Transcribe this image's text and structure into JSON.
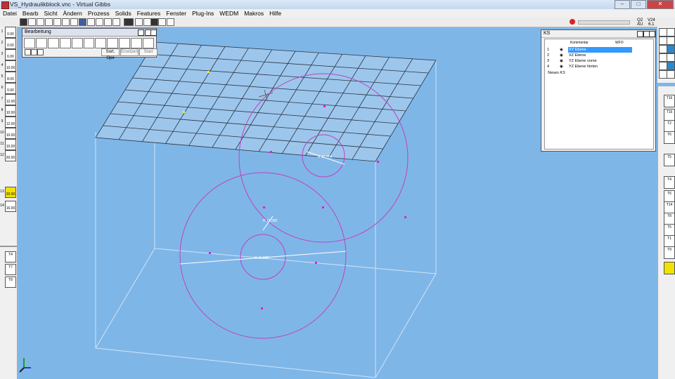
{
  "window": {
    "title": "VS_Hydraulikblock.vnc - Virtual Gibbs",
    "minimize": "–",
    "maximize": "□",
    "close": "✕"
  },
  "menu": [
    "Datei",
    "Bearb",
    "Sicht",
    "Ändern",
    "Prozess",
    "Solids",
    "Features",
    "Fenster",
    "Plug-Ins",
    "WEDM",
    "Makros",
    "Hilfe"
  ],
  "toolbar": {
    "right_top": "Q2",
    "right_bottom": "AU",
    "right2_top": "V24",
    "right2_bottom": "6.1"
  },
  "bearbeitung": {
    "title": "Bearbeitung",
    "btn_sort": "Sort. Ope",
    "btn_ersetzen": "Ersetzen",
    "btn_start": "Start"
  },
  "ks_panel": {
    "title": "KS",
    "col_kommentar": "Kommentar",
    "col_wfo": "WFO",
    "rows": [
      {
        "num": "1",
        "name": "XY Ebene",
        "selected": true
      },
      {
        "num": "2",
        "name": "XZ Ebene",
        "selected": false
      },
      {
        "num": "3",
        "name": "YZ Ebene vorne",
        "selected": false
      },
      {
        "num": "4",
        "name": "YZ Ebene hinten",
        "selected": false
      }
    ],
    "new_ks": "Neues KS"
  },
  "left_tools": [
    {
      "num": "1",
      "label": "0.00"
    },
    {
      "num": "2",
      "label": "0.00"
    },
    {
      "num": "3",
      "label": "6.00"
    },
    {
      "num": "4",
      "label": "10.00"
    },
    {
      "num": "5",
      "label": "8.00"
    },
    {
      "num": "6",
      "label": "0.00"
    },
    {
      "num": "7",
      "label": "12.00"
    },
    {
      "num": "8",
      "label": "10.00"
    },
    {
      "num": "9",
      "label": "12.00"
    },
    {
      "num": "10",
      "label": "10.00"
    },
    {
      "num": "11",
      "label": "10.00"
    },
    {
      "num": "12",
      "label": "20.00"
    },
    {
      "num": "13",
      "label": "20.00"
    },
    {
      "num": "14",
      "label": "16.00"
    }
  ],
  "left_tools2": [
    {
      "label": "T4"
    },
    {
      "label": "T7"
    },
    {
      "label": "T8"
    }
  ],
  "right_tools": [
    {
      "num": "1",
      "label": "T16"
    },
    {
      "num": "2",
      "label": "T15"
    },
    {
      "num": "3",
      "label": "T2"
    },
    {
      "num": "4",
      "label": "T6"
    },
    {
      "num": "5",
      "label": "T5"
    },
    {
      "num": "6",
      "label": "T4"
    },
    {
      "num": "7",
      "label": "T6"
    },
    {
      "num": "8",
      "label": "T14"
    },
    {
      "num": "9",
      "label": "T8"
    },
    {
      "num": "10",
      "label": "T5"
    },
    {
      "num": "11",
      "label": "T1"
    },
    {
      "num": "12",
      "label": "T9"
    }
  ],
  "dimensions": {
    "d1": "R 15.000",
    "d2": "R 15.000",
    "d3": "R 15.000"
  },
  "colors": {
    "background": "#7fb6e8",
    "circle": "#c040c0",
    "point": "#e020d0",
    "grid": "#2a3340",
    "selection": "#3399ff",
    "highlight": "#f3e200"
  }
}
